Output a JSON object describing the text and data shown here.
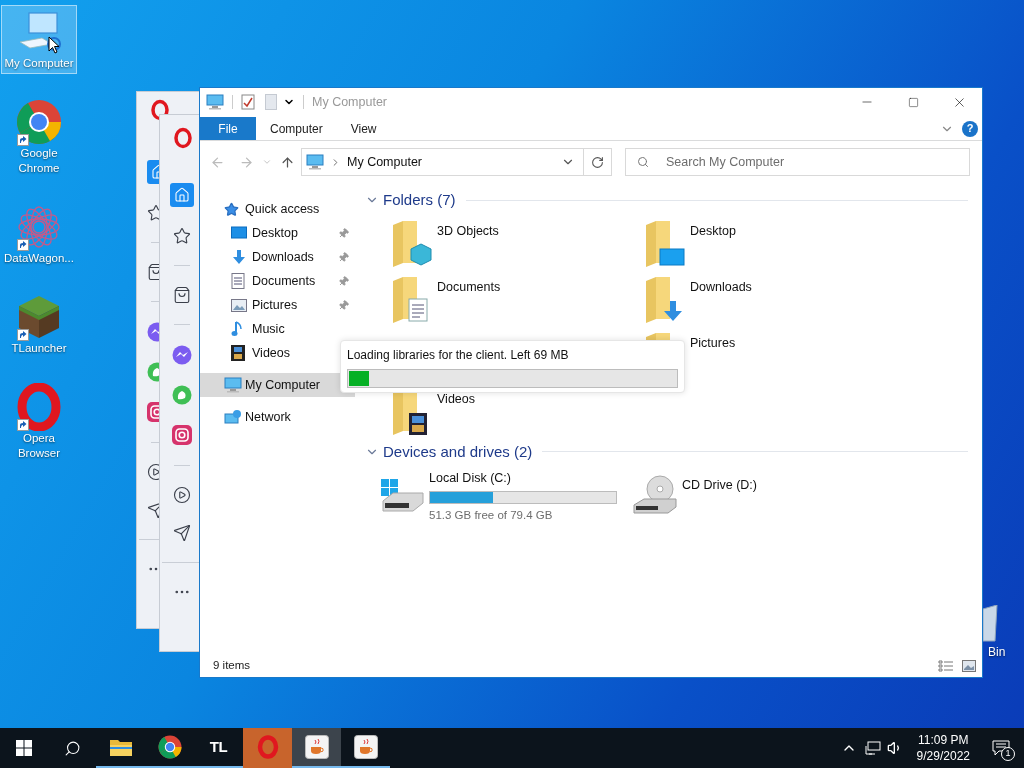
{
  "desktop_icons": [
    {
      "label": "My Computer",
      "kind": "computer",
      "selected": true,
      "shortcut": false
    },
    {
      "label": "Google Chrome",
      "kind": "chrome",
      "selected": false,
      "shortcut": true
    },
    {
      "label": "DataWagon...",
      "kind": "datawagon",
      "selected": false,
      "shortcut": true
    },
    {
      "label": "TLauncher",
      "kind": "tlauncher",
      "selected": false,
      "shortcut": true
    },
    {
      "label": "Opera Browser",
      "kind": "opera",
      "selected": false,
      "shortcut": true
    }
  ],
  "recycle_bin": {
    "label": "Bin"
  },
  "explorer": {
    "title": "My Computer",
    "ribbon_tabs": [
      {
        "label": "File",
        "selected": true
      },
      {
        "label": "Computer",
        "selected": false
      },
      {
        "label": "View",
        "selected": false
      }
    ],
    "help": "?",
    "address": "My Computer",
    "search": {
      "placeholder": "Search My Computer"
    },
    "nav": [
      {
        "label": "Quick access",
        "kind": "quick",
        "selected": false,
        "children": [
          {
            "label": "Desktop",
            "kind": "desktop",
            "pinned": true,
            "selected": false
          },
          {
            "label": "Downloads",
            "kind": "downloads",
            "pinned": true,
            "selected": false
          },
          {
            "label": "Documents",
            "kind": "documents",
            "pinned": true,
            "selected": false
          },
          {
            "label": "Pictures",
            "kind": "pictures",
            "pinned": true,
            "selected": false
          },
          {
            "label": "Music",
            "kind": "music",
            "pinned": false,
            "selected": false
          },
          {
            "label": "Videos",
            "kind": "videos",
            "pinned": false,
            "selected": false
          }
        ]
      },
      {
        "label": "My Computer",
        "kind": "computer",
        "selected": true
      },
      {
        "label": "Network",
        "kind": "network",
        "selected": false
      }
    ],
    "folders": {
      "title": "Folders (7)",
      "expanded": true,
      "items": [
        {
          "label": "3D Objects",
          "kind": "cube"
        },
        {
          "label": "Desktop",
          "kind": "desktop"
        },
        {
          "label": "Documents",
          "kind": "documents"
        },
        {
          "label": "Downloads",
          "kind": "downloads"
        },
        {
          "label": "Pictures",
          "kind": "pictures"
        },
        {
          "label": "Videos",
          "kind": "videos"
        }
      ]
    },
    "drives": {
      "title": "Devices and drives (2)",
      "expanded": true,
      "items": [
        {
          "label": "Local Disk (C:)",
          "kind": "hdd",
          "level": 0.34,
          "free": "51.3 GB free of 79.4 GB"
        },
        {
          "label": "CD Drive (D:)",
          "kind": "cd"
        }
      ]
    },
    "status": "9 items",
    "loading": {
      "message": "Loading libraries for the client. Left 69 MB",
      "level": 0.06
    }
  },
  "taskbar": {
    "apps": [
      {
        "kind": "explorer",
        "flashing": false,
        "selected": false
      },
      {
        "kind": "chrome",
        "flashing": false,
        "selected": false
      },
      {
        "kind": "tl",
        "label": "TL",
        "flashing": false,
        "selected": false
      },
      {
        "kind": "opera",
        "flashing": true,
        "selected": false
      },
      {
        "kind": "java",
        "flashing": false,
        "selected": true
      },
      {
        "kind": "java",
        "flashing": false,
        "selected": false
      }
    ],
    "time": "11:09 PM",
    "date": "9/29/2022",
    "notifications": "1"
  }
}
